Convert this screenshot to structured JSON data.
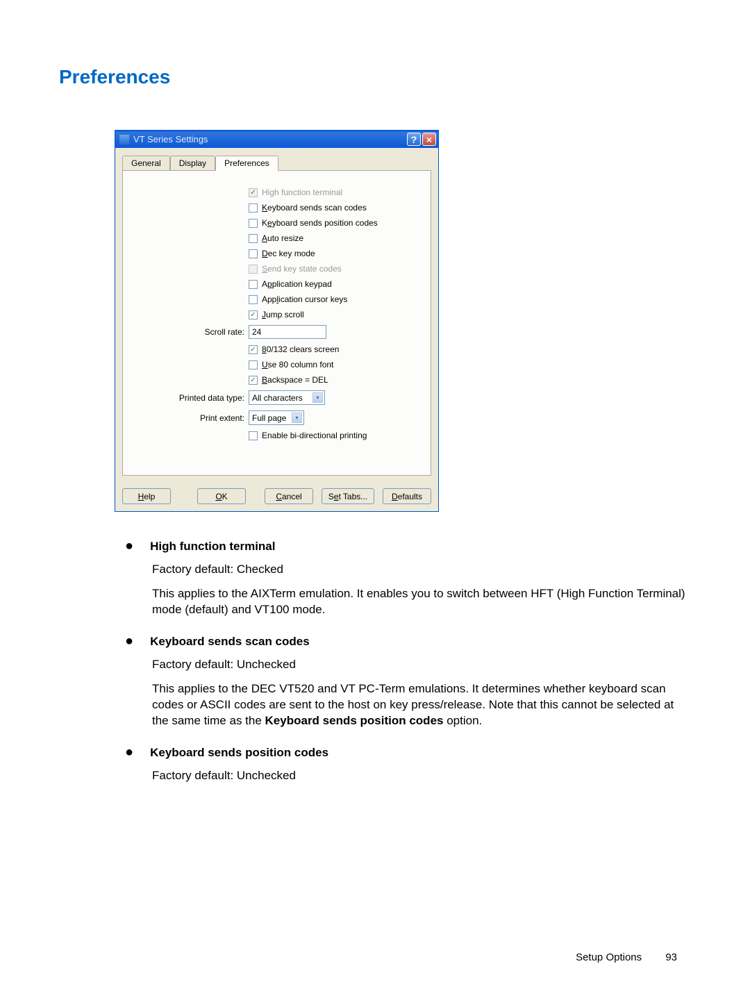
{
  "heading": "Preferences",
  "dialog": {
    "title": "VT Series Settings",
    "tabs": [
      "General",
      "Display",
      "Preferences"
    ],
    "active_tab": "Preferences",
    "checkboxes": {
      "high_function": "High function terminal",
      "kb_scan": "Keyboard sends scan codes",
      "kb_position": "Keyboard sends position codes",
      "auto_resize": "Auto resize",
      "dec_key": "Dec key mode",
      "send_key_state": "Send key state codes",
      "app_keypad": "Application keypad",
      "app_cursor": "Application cursor keys",
      "jump_scroll": "Jump scroll",
      "clears_screen": "80/132 clears screen",
      "use_80_font": "Use 80 column font",
      "backspace_del": "Backspace = DEL",
      "enable_bidi": "Enable bi-directional printing"
    },
    "labels": {
      "scroll_rate": "Scroll rate:",
      "printed_data_type": "Printed data type:",
      "print_extent": "Print extent:"
    },
    "values": {
      "scroll_rate": "24",
      "printed_data_type": "All characters",
      "print_extent": "Full page"
    },
    "buttons": {
      "help": "Help",
      "ok": "OK",
      "cancel": "Cancel",
      "set_tabs": "Set Tabs...",
      "defaults": "Defaults"
    }
  },
  "doc": {
    "items": [
      {
        "title": "High function terminal",
        "default": "Factory default: Checked",
        "body": "This applies to the AIXTerm emulation. It enables you to switch between HFT (High Function Terminal) mode (default) and VT100 mode."
      },
      {
        "title": "Keyboard sends scan codes",
        "default": "Factory default: Unchecked",
        "body_pre": "This applies to the DEC VT520 and VT PC-Term emulations. It determines whether keyboard scan codes or ASCII codes are sent to the host on key press/release. Note that this cannot be selected at the same time as the ",
        "body_bold": "Keyboard sends position codes",
        "body_post": " option."
      },
      {
        "title": "Keyboard sends position codes",
        "default": "Factory default: Unchecked",
        "body": ""
      }
    ]
  },
  "footer": {
    "section": "Setup Options",
    "page": "93"
  }
}
